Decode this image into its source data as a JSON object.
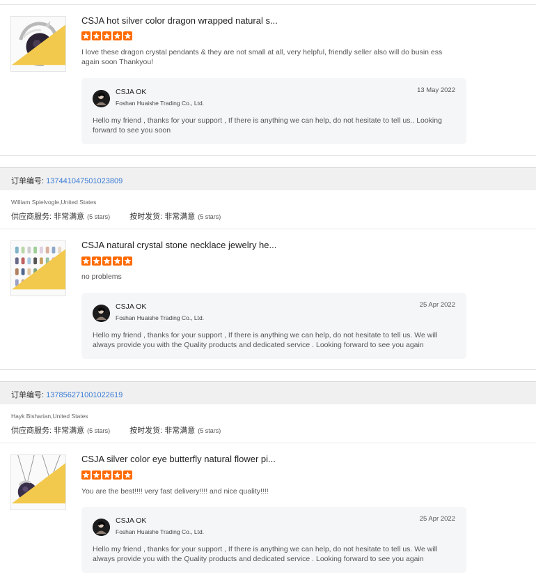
{
  "reviews": [
    {
      "order": null,
      "title": "CSJA hot silver color dragon wrapped natural s...",
      "stars": 5,
      "comment": "I love these dragon crystal pendants & they are not small at all, very helpful, friendly seller also will do busin ess again soon Thankyou!",
      "reply": {
        "seller": "CSJA OK",
        "company": "Foshan Huaishe Trading Co., Ltd.",
        "date": "13 May 2022",
        "text": "Hello my friend , thanks for your support , If there is anything we can help, do not hesitate to tell us.. Looking forward to see you soon"
      }
    },
    {
      "order_label": "订单编号:",
      "order_number": "137441047501023809",
      "buyer": "William Spielvogle,United States",
      "supplier_label": "供应商服务: 非常满意",
      "supplier_stars": "(5 stars)",
      "shipping_label": "按时发货: 非常满意",
      "shipping_stars": "(5 stars)",
      "title": "CSJA natural crystal stone necklace jewelry he...",
      "stars": 5,
      "comment": "no problems",
      "reply": {
        "seller": "CSJA OK",
        "company": "Foshan Huaishe Trading Co., Ltd.",
        "date": "25 Apr 2022",
        "text": "Hello my friend , thanks for your support , If there is anything we can help, do not hesitate to tell us. We will always provide you with the Quality products and dedicated service . Looking forward to see you again"
      }
    },
    {
      "order_label": "订单编号:",
      "order_number": "137856271001022619",
      "buyer": "Hayk Bisharian,United States",
      "supplier_label": "供应商服务: 非常满意",
      "supplier_stars": "(5 stars)",
      "shipping_label": "按时发货: 非常满意",
      "shipping_stars": "(5 stars)",
      "title": "CSJA silver color eye butterfly natural flower pi...",
      "stars": 5,
      "comment": "You are the best!!!! very fast delivery!!!! and nice quality!!!!",
      "reply": {
        "seller": "CSJA OK",
        "company": "Foshan Huaishe Trading Co., Ltd.",
        "date": "25 Apr 2022",
        "text": "Hello my friend , thanks for your support , If there is anything we can help, do not hesitate to tell us. We will always provide you with the Quality products and dedicated service . Looking forward to see you again"
      }
    }
  ],
  "colors": {
    "star": "#ff6a00",
    "order_number": "#3a7bd5",
    "reply_bg": "#f5f6f8",
    "order_bar": "#f0f0f0"
  },
  "icons": {
    "rating": "star-icon",
    "avatar": "seller-avatar"
  }
}
